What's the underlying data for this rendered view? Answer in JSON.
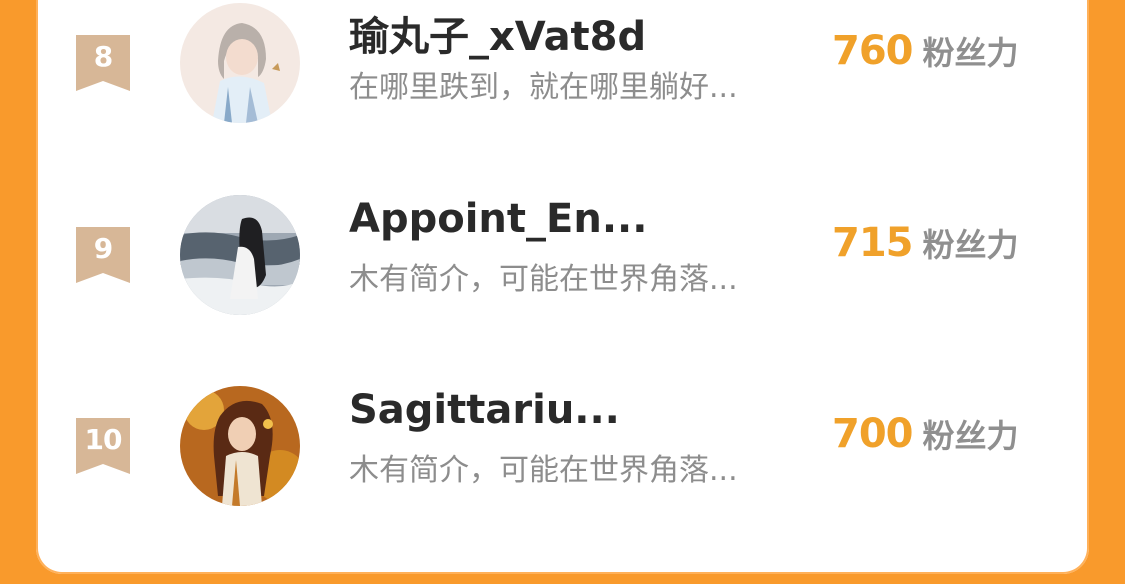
{
  "ranking": {
    "unit": "粉丝力",
    "entries": [
      {
        "rank": "8",
        "name": "瑜丸子_xVat8d",
        "bio": "在哪里跌到，就在哪里躺好...",
        "score": "760",
        "avatar_icon": "anime-girl-avatar"
      },
      {
        "rank": "9",
        "name": "Appoint_En...",
        "bio": "木有简介，可能在世界角落...",
        "score": "715",
        "avatar_icon": "seaside-girl-avatar"
      },
      {
        "rank": "10",
        "name": "Sagittariu...",
        "bio": "木有简介，可能在世界角落...",
        "score": "700",
        "avatar_icon": "autumn-girl-avatar"
      }
    ]
  },
  "colors": {
    "background": "#f99a2c",
    "card": "#ffffff",
    "score": "#f0a12a",
    "rank_badge": "#d7b797"
  }
}
